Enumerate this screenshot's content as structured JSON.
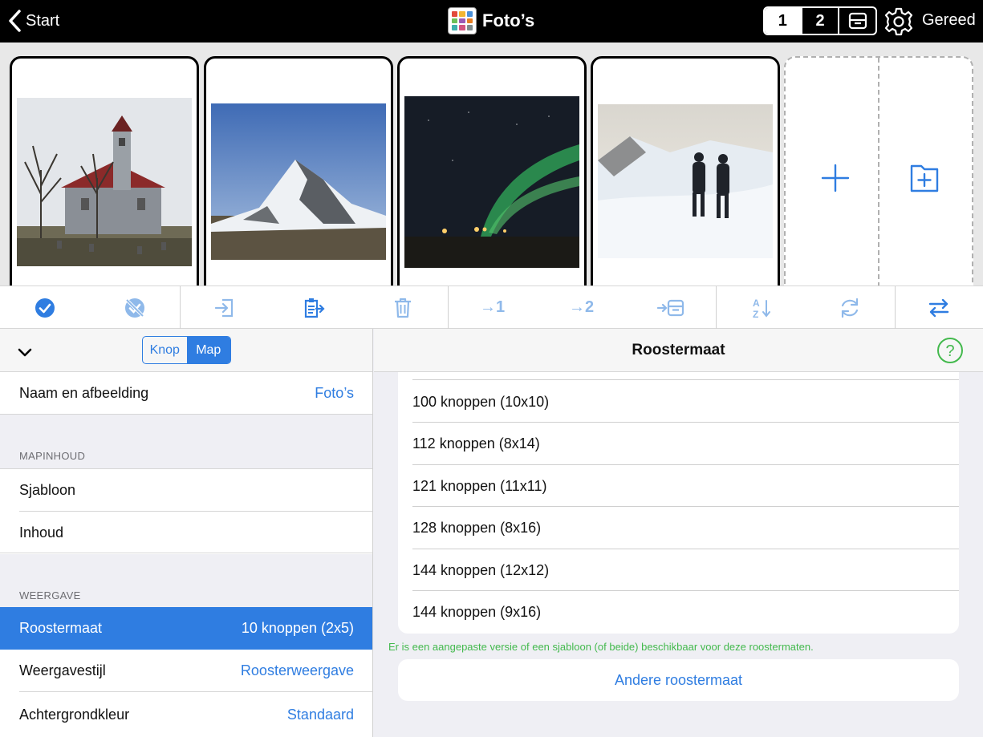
{
  "topbar": {
    "back_label": "Start",
    "title": "Foto’s",
    "pages": [
      "1",
      "2"
    ],
    "done_label": "Gereed"
  },
  "toolbar": {
    "move_to_1": "→1",
    "move_to_2": "→2"
  },
  "left_panel": {
    "mode_tabs": [
      "Knop",
      "Map"
    ],
    "name_row": {
      "label": "Naam en afbeelding",
      "value": "Foto’s"
    },
    "section_content": "MAPINHOUD",
    "template_row": "Sjabloon",
    "content_row": "Inhoud",
    "section_display": "WEERGAVE",
    "grid_size_row": {
      "label": "Roostermaat",
      "value": "10 knoppen (2x5)"
    },
    "display_style_row": {
      "label": "Weergavestijl",
      "value": "Roosterweergave"
    },
    "background_row": {
      "label": "Achtergrondkleur",
      "value": "Standaard"
    }
  },
  "right_panel": {
    "title": "Roostermaat",
    "options": [
      "100 knoppen (10x10)",
      "112 knoppen (8x14)",
      "121 knoppen (11x11)",
      "128 knoppen (8x16)",
      "144 knoppen (12x12)",
      "144 knoppen (9x16)"
    ],
    "note": "Er is een aangepaste versie of een sjabloon (of beide) beschikbaar voor deze roostermaten.",
    "other_button": "Andere roostermaat"
  },
  "colors": {
    "accent": "#2f7de1",
    "accent_light": "#8fb9ea",
    "note_green": "#43b94d"
  }
}
